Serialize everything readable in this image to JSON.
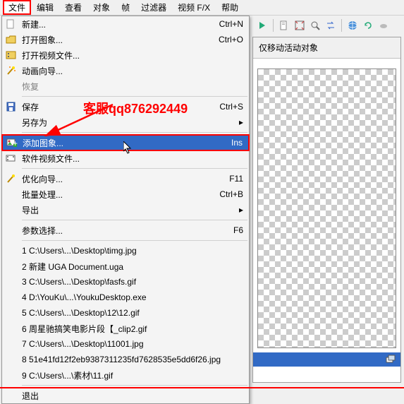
{
  "menubar": {
    "items": [
      "文件",
      "编辑",
      "查看",
      "对象",
      "帧",
      "过滤器",
      "视频 F/X",
      "帮助"
    ],
    "active_index": 0
  },
  "overlay": {
    "text": "客服qq876292449"
  },
  "right_panel": {
    "header": "仅移动活动对象"
  },
  "dropdown": {
    "groups": [
      [
        {
          "icon": "new-icon",
          "label": "新建...",
          "shortcut": "Ctrl+N"
        },
        {
          "icon": "open-icon",
          "label": "打开图象...",
          "shortcut": "Ctrl+O"
        },
        {
          "icon": "video-open-icon",
          "label": "打开视频文件..."
        },
        {
          "icon": "wizard-icon",
          "label": "动画向导..."
        },
        {
          "icon": "",
          "label": "恢复",
          "disabled": true
        }
      ],
      [
        {
          "icon": "save-icon",
          "label": "保存",
          "shortcut": "Ctrl+S"
        },
        {
          "icon": "",
          "label": "另存为",
          "arrow": true
        }
      ],
      [
        {
          "icon": "add-image-icon",
          "label": "添加图象...",
          "shortcut": "Ins",
          "highlight": true
        },
        {
          "icon": "add-video-icon",
          "label": "软件视频文件..."
        }
      ],
      [
        {
          "icon": "optimize-icon",
          "label": "优化向导...",
          "shortcut": "F11"
        },
        {
          "icon": "",
          "label": "批量处理...",
          "shortcut": "Ctrl+B"
        },
        {
          "icon": "",
          "label": "导出",
          "arrow": true
        }
      ],
      [
        {
          "icon": "",
          "label": "参数选择...",
          "shortcut": "F6"
        }
      ],
      [
        {
          "icon": "",
          "label": "1 C:\\Users\\...\\Desktop\\timg.jpg"
        },
        {
          "icon": "",
          "label": "2 新建 UGA Document.uga"
        },
        {
          "icon": "",
          "label": "3 C:\\Users\\...\\Desktop\\fasfs.gif"
        },
        {
          "icon": "",
          "label": "4 D:\\YouKu\\...\\YoukuDesktop.exe"
        },
        {
          "icon": "",
          "label": "5 C:\\Users\\...\\Desktop\\12\\12.gif"
        },
        {
          "icon": "",
          "label": "6 周星驰搞笑电影片段【_clip2.gif"
        },
        {
          "icon": "",
          "label": "7 C:\\Users\\...\\Desktop\\11001.jpg"
        },
        {
          "icon": "",
          "label": "8 51e41fd12f2eb9387311235fd7628535e5dd6f26.jpg"
        },
        {
          "icon": "",
          "label": "9 C:\\Users\\...\\素材\\11.gif"
        }
      ],
      [
        {
          "icon": "",
          "label": "退出"
        }
      ]
    ]
  },
  "toolbar_icons": [
    "play-icon",
    "page-icon",
    "fit-icon",
    "zoom-icon",
    "swap-icon",
    "globe-icon",
    "refresh-icon",
    "cloud-icon"
  ]
}
